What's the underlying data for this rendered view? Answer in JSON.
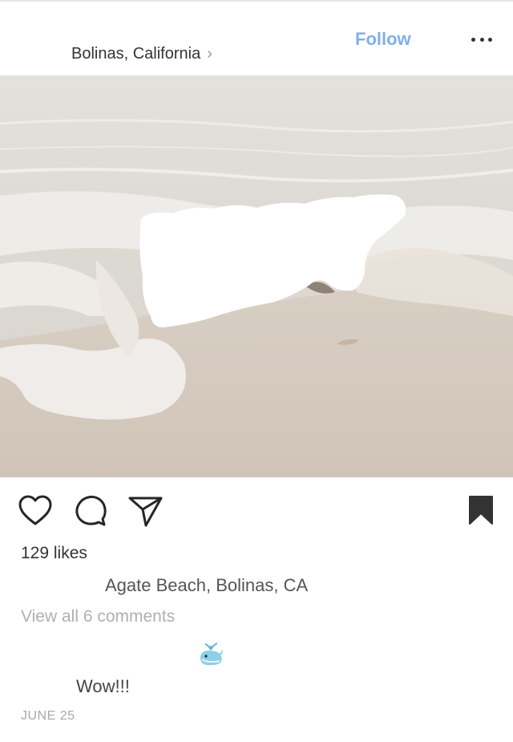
{
  "post": {
    "location": "Bolinas, California",
    "location_chevron": "›",
    "follow_label": "Follow"
  },
  "icons": {
    "more": "more-icon",
    "like": "heart-icon",
    "comment": "comment-icon",
    "share": "share-icon",
    "save": "bookmark-icon"
  },
  "stats": {
    "likes_text": "129 likes"
  },
  "caption": {
    "text": "Agate Beach, Bolinas, CA"
  },
  "comments": {
    "view_all": "View all 6 comments",
    "items": [
      {
        "text": "Wow!!!"
      }
    ],
    "emoji_comment": "whale-emoji"
  },
  "date": "JUNE 25",
  "colors": {
    "follow": "#7fb0ea",
    "sand": "#d4cbc0",
    "water": "#ddd9d3"
  }
}
